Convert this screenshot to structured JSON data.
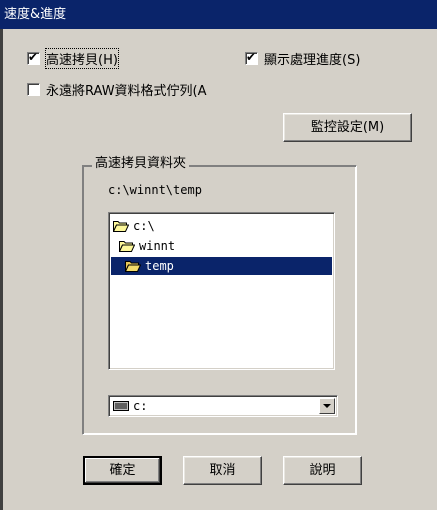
{
  "dialog": {
    "title": "速度&進度"
  },
  "options": {
    "high_speed_copy": {
      "label": "高速拷貝(H)",
      "checked": true
    },
    "show_progress": {
      "label": "顯示處理進度(S)",
      "checked": true
    },
    "keep_raw": {
      "label": "永遠將RAW資料格式佇列(A",
      "checked": false
    }
  },
  "monitor_button": {
    "label": "監控設定(M)"
  },
  "copy_folder": {
    "legend": "高速拷貝資料夾",
    "current_path": "c:\\winnt\\temp",
    "folders": [
      {
        "name": "c:\\",
        "state": "open",
        "selected": false
      },
      {
        "name": "winnt",
        "state": "open",
        "selected": false
      },
      {
        "name": "temp",
        "state": "open",
        "selected": true
      }
    ],
    "drive": {
      "value": "c:"
    }
  },
  "buttons": {
    "ok": "確定",
    "cancel": "取消",
    "help": "說明"
  },
  "colors": {
    "titlebar": "#0a246a",
    "face": "#d4d0c8",
    "selection": "#0a246a"
  }
}
